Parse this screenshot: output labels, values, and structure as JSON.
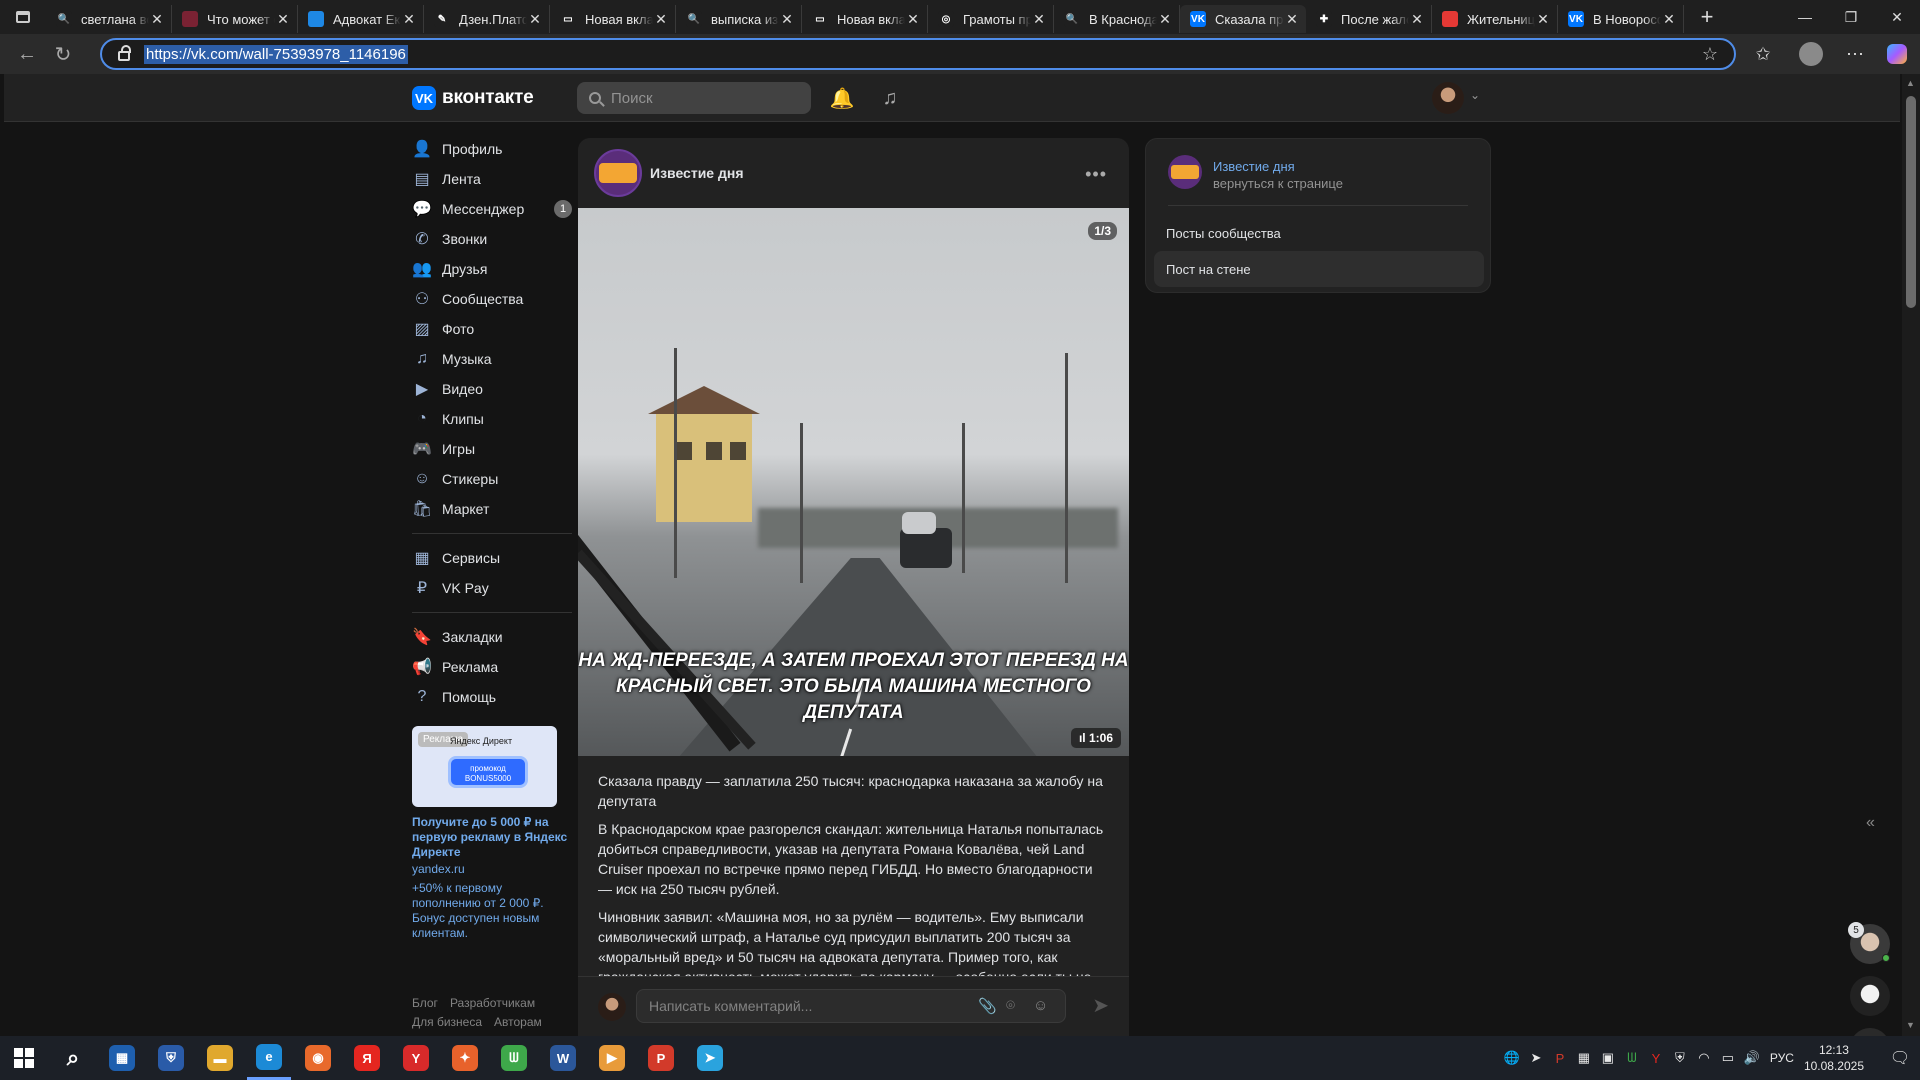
{
  "browser": {
    "tabs": [
      {
        "title": "светлана во",
        "color": "#1f1f1f",
        "glyph": "🔍"
      },
      {
        "title": "Что может с",
        "color": "#7a2233",
        "glyph": ""
      },
      {
        "title": "Адвокат Ека",
        "color": "#1e88e5",
        "glyph": ""
      },
      {
        "title": "Дзен.Платф",
        "color": "#1f1f1f",
        "glyph": "✎"
      },
      {
        "title": "Новая вклад",
        "color": "#1f1f1f",
        "glyph": "▭"
      },
      {
        "title": "выписка из",
        "color": "#1f1f1f",
        "glyph": "🔍"
      },
      {
        "title": "Новая вклад",
        "color": "#1f1f1f",
        "glyph": "▭"
      },
      {
        "title": "Грамоты пр",
        "color": "#1f1f1f",
        "glyph": "◎"
      },
      {
        "title": "В Краснода",
        "color": "#1f1f1f",
        "glyph": "🔍"
      },
      {
        "title": "Сказала пра",
        "color": "#0077ff",
        "glyph": "VK",
        "active": true
      },
      {
        "title": "После жало",
        "color": "#1f1f1f",
        "glyph": "✚"
      },
      {
        "title": "Жительниц",
        "color": "#e53935",
        "glyph": ""
      },
      {
        "title": "В Новоросс",
        "color": "#0077ff",
        "glyph": "VK"
      }
    ],
    "url": "https://vk.com/wall-75393978_1146196"
  },
  "vk": {
    "logo_text": "вконтакте",
    "search_placeholder": "Поиск",
    "nav": [
      {
        "label": "Профиль",
        "icon": "👤",
        "name": "profile"
      },
      {
        "label": "Лента",
        "icon": "▤",
        "name": "feed"
      },
      {
        "label": "Мессенджер",
        "icon": "💬",
        "name": "messenger",
        "count": "1"
      },
      {
        "label": "Звонки",
        "icon": "✆",
        "name": "calls"
      },
      {
        "label": "Друзья",
        "icon": "👥",
        "name": "friends"
      },
      {
        "label": "Сообщества",
        "icon": "⚇",
        "name": "communities"
      },
      {
        "label": "Фото",
        "icon": "▨",
        "name": "photos"
      },
      {
        "label": "Музыка",
        "icon": "♫",
        "name": "music"
      },
      {
        "label": "Видео",
        "icon": "▶",
        "name": "video"
      },
      {
        "label": "Клипы",
        "icon": "◔",
        "name": "clips"
      },
      {
        "label": "Игры",
        "icon": "🎮",
        "name": "games"
      },
      {
        "label": "Стикеры",
        "icon": "☺",
        "name": "stickers"
      },
      {
        "label": "Маркет",
        "icon": "🛍",
        "name": "market"
      }
    ],
    "nav2": [
      {
        "label": "Сервисы",
        "icon": "▦",
        "name": "services"
      },
      {
        "label": "VK Pay",
        "icon": "₽",
        "name": "vkpay"
      }
    ],
    "nav3": [
      {
        "label": "Закладки",
        "icon": "🔖",
        "name": "bookmarks"
      },
      {
        "label": "Реклама",
        "icon": "📢",
        "name": "ads"
      },
      {
        "label": "Помощь",
        "icon": "?",
        "name": "help"
      }
    ],
    "ad": {
      "badge": "Реклама",
      "brand": "Яндекс Директ",
      "promo": "промокод BONUS5000",
      "title": "Получите до 5 000 ₽ на первую рекламу в Яндекс Директе",
      "domain": "yandex.ru",
      "desc": "+50% к первому пополнению от 2 000 ₽. Бонус доступен новым клиентам."
    },
    "footer": {
      "row1": [
        "Блог",
        "Разработчикам"
      ],
      "row2": [
        "Для бизнеса",
        "Авторам"
      ]
    },
    "post": {
      "group": "Известие дня",
      "counter": "1/3",
      "duration": "1:06",
      "caption_line1": "НА ЖД-ПЕРЕЕЗДЕ, А ЗАТЕМ ПРОЕХАЛ ЭТОТ ПЕРЕЕЗД НА",
      "caption_line2": "КРАСНЫЙ СВЕТ. ЭТО БЫЛА МАШИНА МЕСТНОГО ДЕПУТАТА",
      "paragraphs": [
        "Сказала правду — заплатила 250 тысяч: краснодарка наказана за жалобу на депутата",
        "В Краснодарском крае разгорелся скандал: жительница Наталья попыталась добиться справедливости, указав на депутата Романа Ковалёва, чей Land Cruiser проехал по встречке прямо перед ГИБДД. Но вместо благодарности — иск на 250 тысяч рублей.",
        "Чиновник заявил: «Машина моя, но за рулём — водитель». Ему выписали символический штраф, а Наталье суд присудил выплатить 200 тысяч за «моральный вред» и 50 тысяч на адвоката депутата. Пример того, как гражданская активность может ударить по карману — особенно если ты не"
      ],
      "comment_placeholder": "Написать комментарий..."
    },
    "side": {
      "group": "Известие дня",
      "back": "вернуться к странице",
      "opt1": "Посты сообщества",
      "opt2": "Пост на стене"
    },
    "chat_count": "5"
  },
  "taskbar": {
    "apps": [
      {
        "glyph": "⌕",
        "color": "transparent",
        "name": "search"
      },
      {
        "glyph": "▦",
        "color": "#1e5fae",
        "name": "store"
      },
      {
        "glyph": "⛨",
        "color": "#2a5ba8",
        "name": "defender"
      },
      {
        "glyph": "▬",
        "color": "#e0a82e",
        "name": "explorer"
      },
      {
        "glyph": "e",
        "color": "#1c8ad6",
        "name": "edge",
        "active": true
      },
      {
        "glyph": "◉",
        "color": "#e8692b",
        "name": "firefox"
      },
      {
        "glyph": "Я",
        "color": "#e52620",
        "name": "yandex"
      },
      {
        "glyph": "Y",
        "color": "#d82a2a",
        "name": "yandex-browser"
      },
      {
        "glyph": "✦",
        "color": "#e8622b",
        "name": "brave"
      },
      {
        "glyph": "ᗯ",
        "color": "#3ea84a",
        "name": "app-green"
      },
      {
        "glyph": "W",
        "color": "#2b579a",
        "name": "word"
      },
      {
        "glyph": "▶",
        "color": "#e89b3a",
        "name": "player"
      },
      {
        "glyph": "P",
        "color": "#d23a2a",
        "name": "app-p"
      },
      {
        "glyph": "➤",
        "color": "#2aa3de",
        "name": "telegram"
      }
    ],
    "lang": "РУС",
    "time": "12:13",
    "date": "10.08.2025"
  }
}
